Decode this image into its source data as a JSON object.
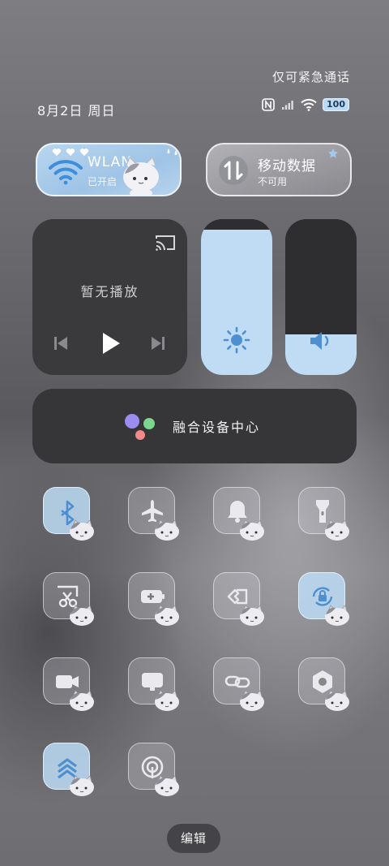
{
  "status_bar": {
    "emergency_text": "仅可紧急通话",
    "date": "8月2日 周日",
    "battery": "100",
    "icons": [
      "nfc-icon",
      "signal-icon",
      "wifi-icon",
      "battery-icon"
    ]
  },
  "toggles": {
    "wlan": {
      "title": "WLAN",
      "subtitle": "已开启",
      "active": true
    },
    "mobile_data": {
      "title": "移动数据",
      "subtitle": "不可用",
      "active": false
    }
  },
  "media": {
    "status": "暂无播放",
    "controls": [
      "previous-icon",
      "play-icon",
      "next-icon",
      "cast-icon"
    ]
  },
  "brightness": {
    "level": 0.93
  },
  "volume": {
    "level": 0.26
  },
  "device_center": {
    "label": "融合设备中心"
  },
  "tiles": [
    {
      "icon": "bluetooth-icon",
      "active": true
    },
    {
      "icon": "airplane-icon",
      "active": false
    },
    {
      "icon": "bell-icon",
      "active": false
    },
    {
      "icon": "flashlight-icon",
      "active": false
    },
    {
      "icon": "screenshot-icon",
      "active": false
    },
    {
      "icon": "battery-saver-icon",
      "active": false
    },
    {
      "icon": "nearby-share-icon",
      "active": false
    },
    {
      "icon": "rotation-lock-icon",
      "active": true
    },
    {
      "icon": "screen-record-icon",
      "active": false
    },
    {
      "icon": "cast-screen-icon",
      "active": false
    },
    {
      "icon": "link-icon",
      "active": false
    },
    {
      "icon": "nfc-tile-icon",
      "active": false
    },
    {
      "icon": "performance-mode-icon",
      "active": true
    },
    {
      "icon": "hotspot-icon",
      "active": false
    }
  ],
  "edit_button": {
    "label": "编辑"
  },
  "colors": {
    "accent": "#bfdcf4",
    "panel": "#3a3a3c",
    "tile_icon": "#e9e9ee",
    "active_icon": "#4d8fd1"
  }
}
